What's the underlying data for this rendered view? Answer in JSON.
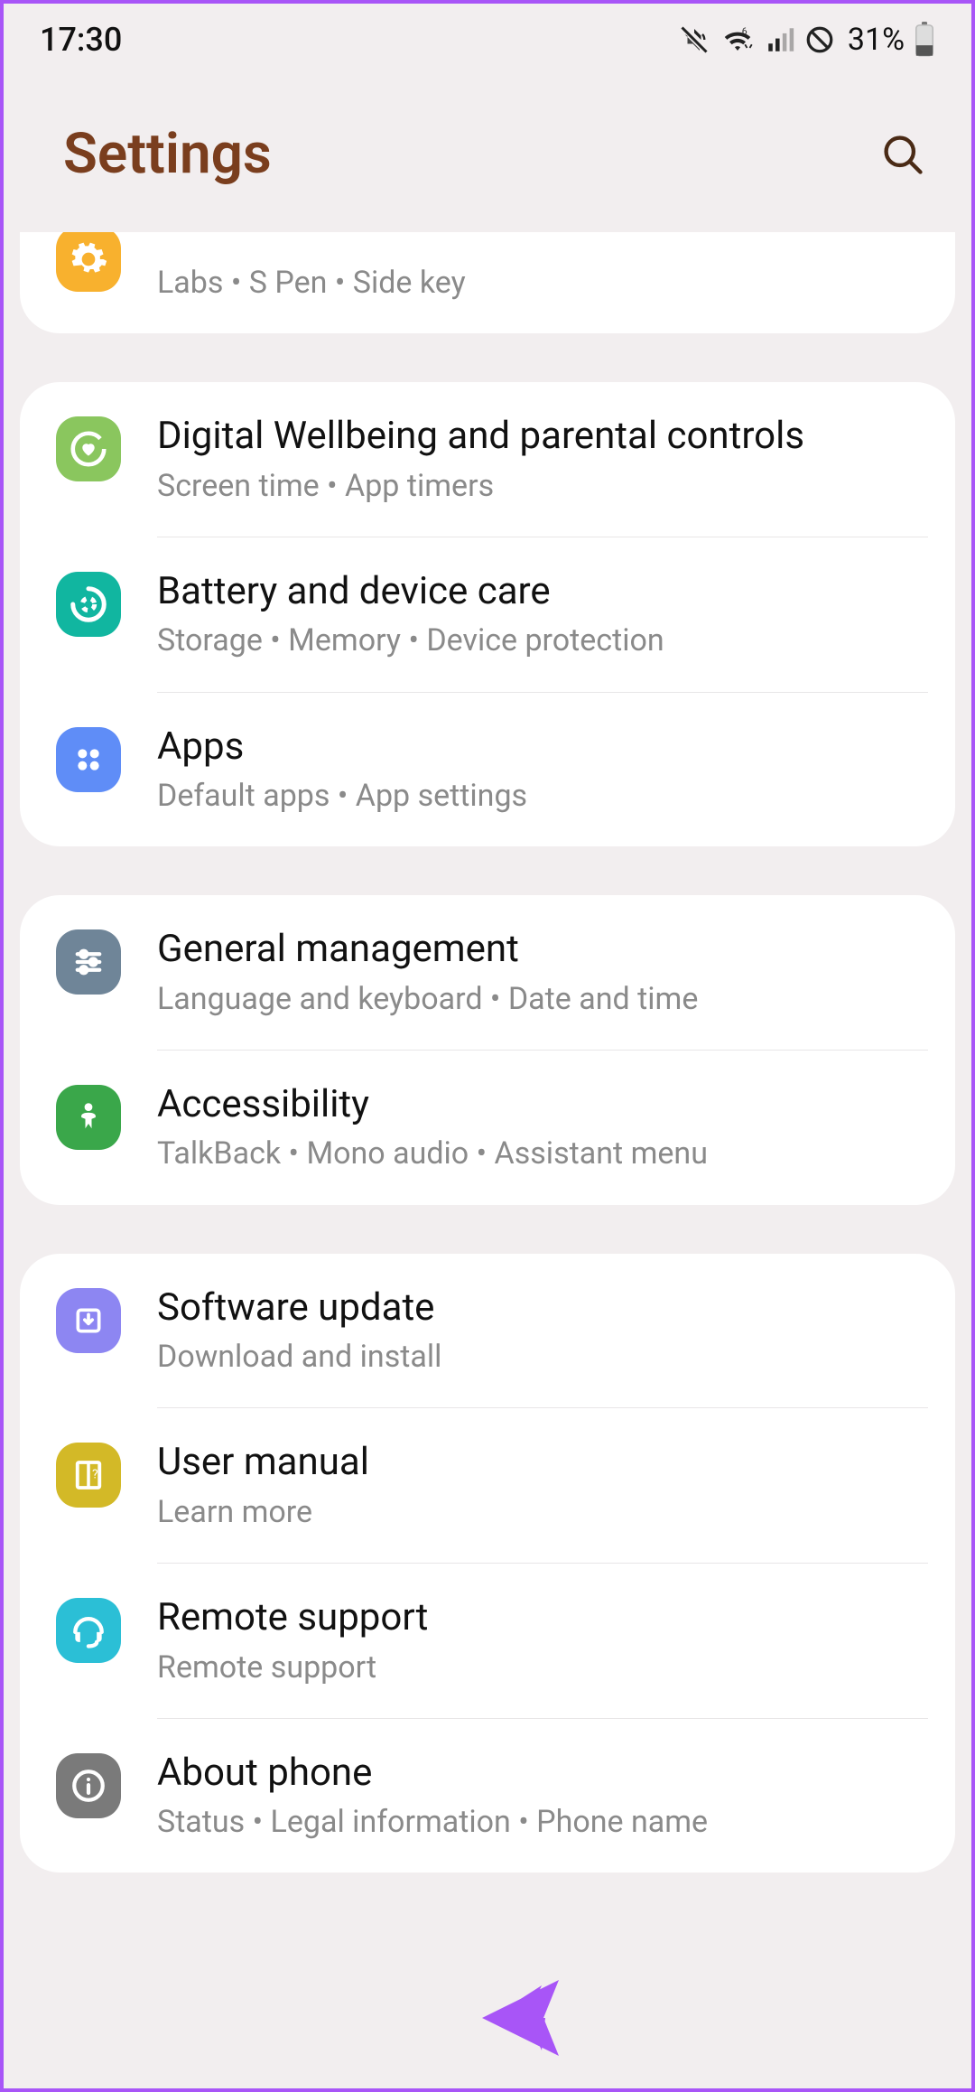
{
  "status": {
    "time": "17:30",
    "battery_pct": "31%"
  },
  "header": {
    "title": "Settings"
  },
  "groups": [
    {
      "partial_top": true,
      "items": [
        {
          "icon": {
            "bg": "#f8b12e",
            "slot": "gear",
            "partial": true,
            "name": "advanced-icon"
          },
          "title": "",
          "sub": "Labs  •  S Pen  •  Side key",
          "name": "row-advanced"
        }
      ]
    },
    {
      "items": [
        {
          "icon": {
            "bg": "#8ac65e",
            "slot": "heart-ring",
            "name": "wellbeing-icon"
          },
          "title": "Digital Wellbeing and parental controls",
          "sub": "Screen time  •  App timers",
          "name": "row-wellbeing"
        },
        {
          "icon": {
            "bg": "#11b6a0",
            "slot": "ring-dots",
            "name": "battery-care-icon"
          },
          "title": "Battery and device care",
          "sub": "Storage  •  Memory  •  Device protection",
          "name": "row-battery-care"
        },
        {
          "icon": {
            "bg": "#5f8df7",
            "slot": "four-dots",
            "name": "apps-icon"
          },
          "title": "Apps",
          "sub": "Default apps  •  App settings",
          "name": "row-apps"
        }
      ]
    },
    {
      "items": [
        {
          "icon": {
            "bg": "#6f8598",
            "slot": "sliders",
            "name": "general-icon"
          },
          "title": "General management",
          "sub": "Language and keyboard  •  Date and time",
          "name": "row-general"
        },
        {
          "icon": {
            "bg": "#3aa74a",
            "slot": "person",
            "name": "accessibility-icon"
          },
          "title": "Accessibility",
          "sub": "TalkBack  •  Mono audio  •  Assistant menu",
          "name": "row-accessibility"
        }
      ]
    },
    {
      "items": [
        {
          "icon": {
            "bg": "#8d86f2",
            "slot": "download-square",
            "name": "update-icon"
          },
          "title": "Software update",
          "sub": "Download and install",
          "name": "row-software-update"
        },
        {
          "icon": {
            "bg": "#d3b927",
            "slot": "book",
            "name": "manual-icon"
          },
          "title": "User manual",
          "sub": "Learn more",
          "name": "row-manual"
        },
        {
          "icon": {
            "bg": "#2bbfd6",
            "slot": "headset",
            "name": "remote-icon"
          },
          "title": "Remote support",
          "sub": "Remote support",
          "name": "row-remote"
        },
        {
          "icon": {
            "bg": "#7a7a7a",
            "slot": "info",
            "name": "about-icon"
          },
          "title": "About phone",
          "sub": "Status  •  Legal information  •  Phone name",
          "name": "row-about"
        }
      ]
    }
  ]
}
